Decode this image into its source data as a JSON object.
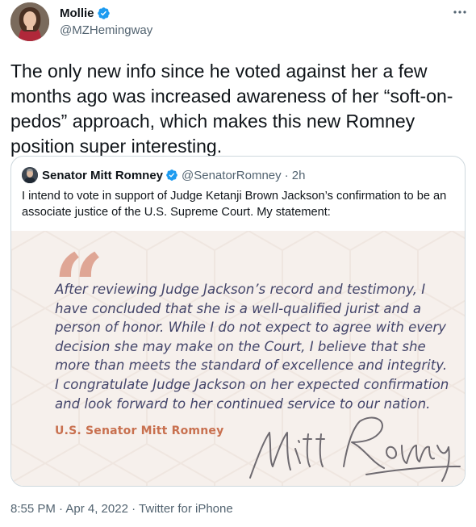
{
  "tweet": {
    "author_name": "Mollie",
    "author_handle": "@MZHemingway",
    "text": "The only new info since he voted against her a few months ago was increased awareness of her “soft-on-pedos” approach, which makes this new Romney position super interesting.",
    "timestamp": "8:55 PM · Apr 4, 2022 · Twitter for iPhone"
  },
  "quoted_tweet": {
    "author_name": "Senator Mitt Romney",
    "author_handle": "@SenatorRomney",
    "time": "· 2h",
    "text": "I intend to vote in support of Judge Ketanji Brown Jackson’s confirmation to be an associate justice of the U.S. Supreme Court. My statement:",
    "image": {
      "quote_mark": "“",
      "statement": "After reviewing Judge Jackson’s record and testimony, I have concluded that she is a well-qualified jurist and a person of honor. While I do not expect to agree with every decision she may make on the Court, I believe that she more than meets the standard of excellence and integrity. I congratulate Judge Jackson on her expected confirmation and look forward to her continued service to our nation.",
      "attribution": "U.S. Senator Mitt Romney",
      "signature": "Mitt Romney"
    }
  },
  "colors": {
    "verified": "#1d9bf0",
    "quote_accent": "#dfa695",
    "statement_text": "#43456a",
    "attribution": "#c8704f",
    "secondary_text": "#536471"
  },
  "icons": {
    "verified": "verified-badge-icon",
    "more": "more-options-icon"
  }
}
